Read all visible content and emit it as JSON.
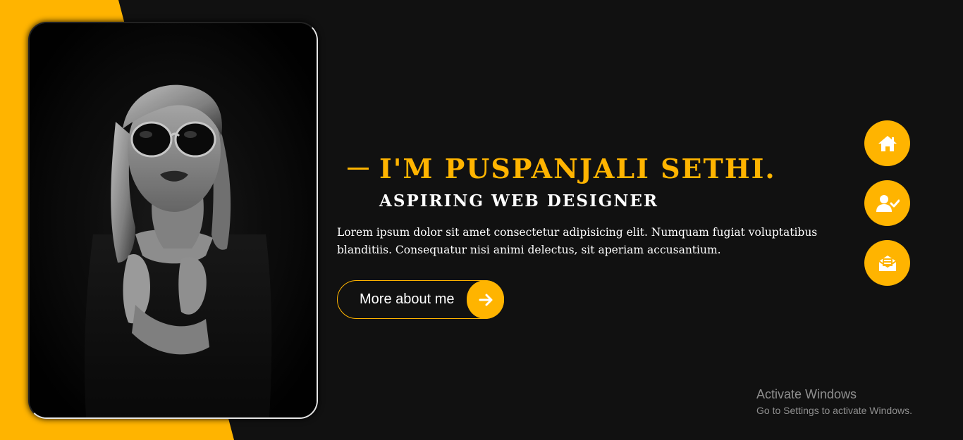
{
  "colors": {
    "accent": "#ffb400",
    "background": "#111111",
    "text": "#ffffff",
    "watermark": "#8f8f8f"
  },
  "hero": {
    "heading": "I'M PUSPANJALI SETHI.",
    "subheading": "ASPIRING WEB DESIGNER",
    "description": "Lorem ipsum dolor sit amet consectetur adipisicing elit. Numquam fugiat voluptatibus blanditiis. Consequatur nisi animi delectus, sit aperiam accusantium.",
    "cta_label": "More about me",
    "cta_icon": "arrow-right-icon"
  },
  "nav": {
    "items": [
      {
        "icon": "home-icon"
      },
      {
        "icon": "user-check-icon"
      },
      {
        "icon": "envelope-open-icon"
      }
    ]
  },
  "photo": {
    "subject": "portrait-photo"
  },
  "watermark": {
    "title": "Activate Windows",
    "subtitle": "Go to Settings to activate Windows."
  }
}
